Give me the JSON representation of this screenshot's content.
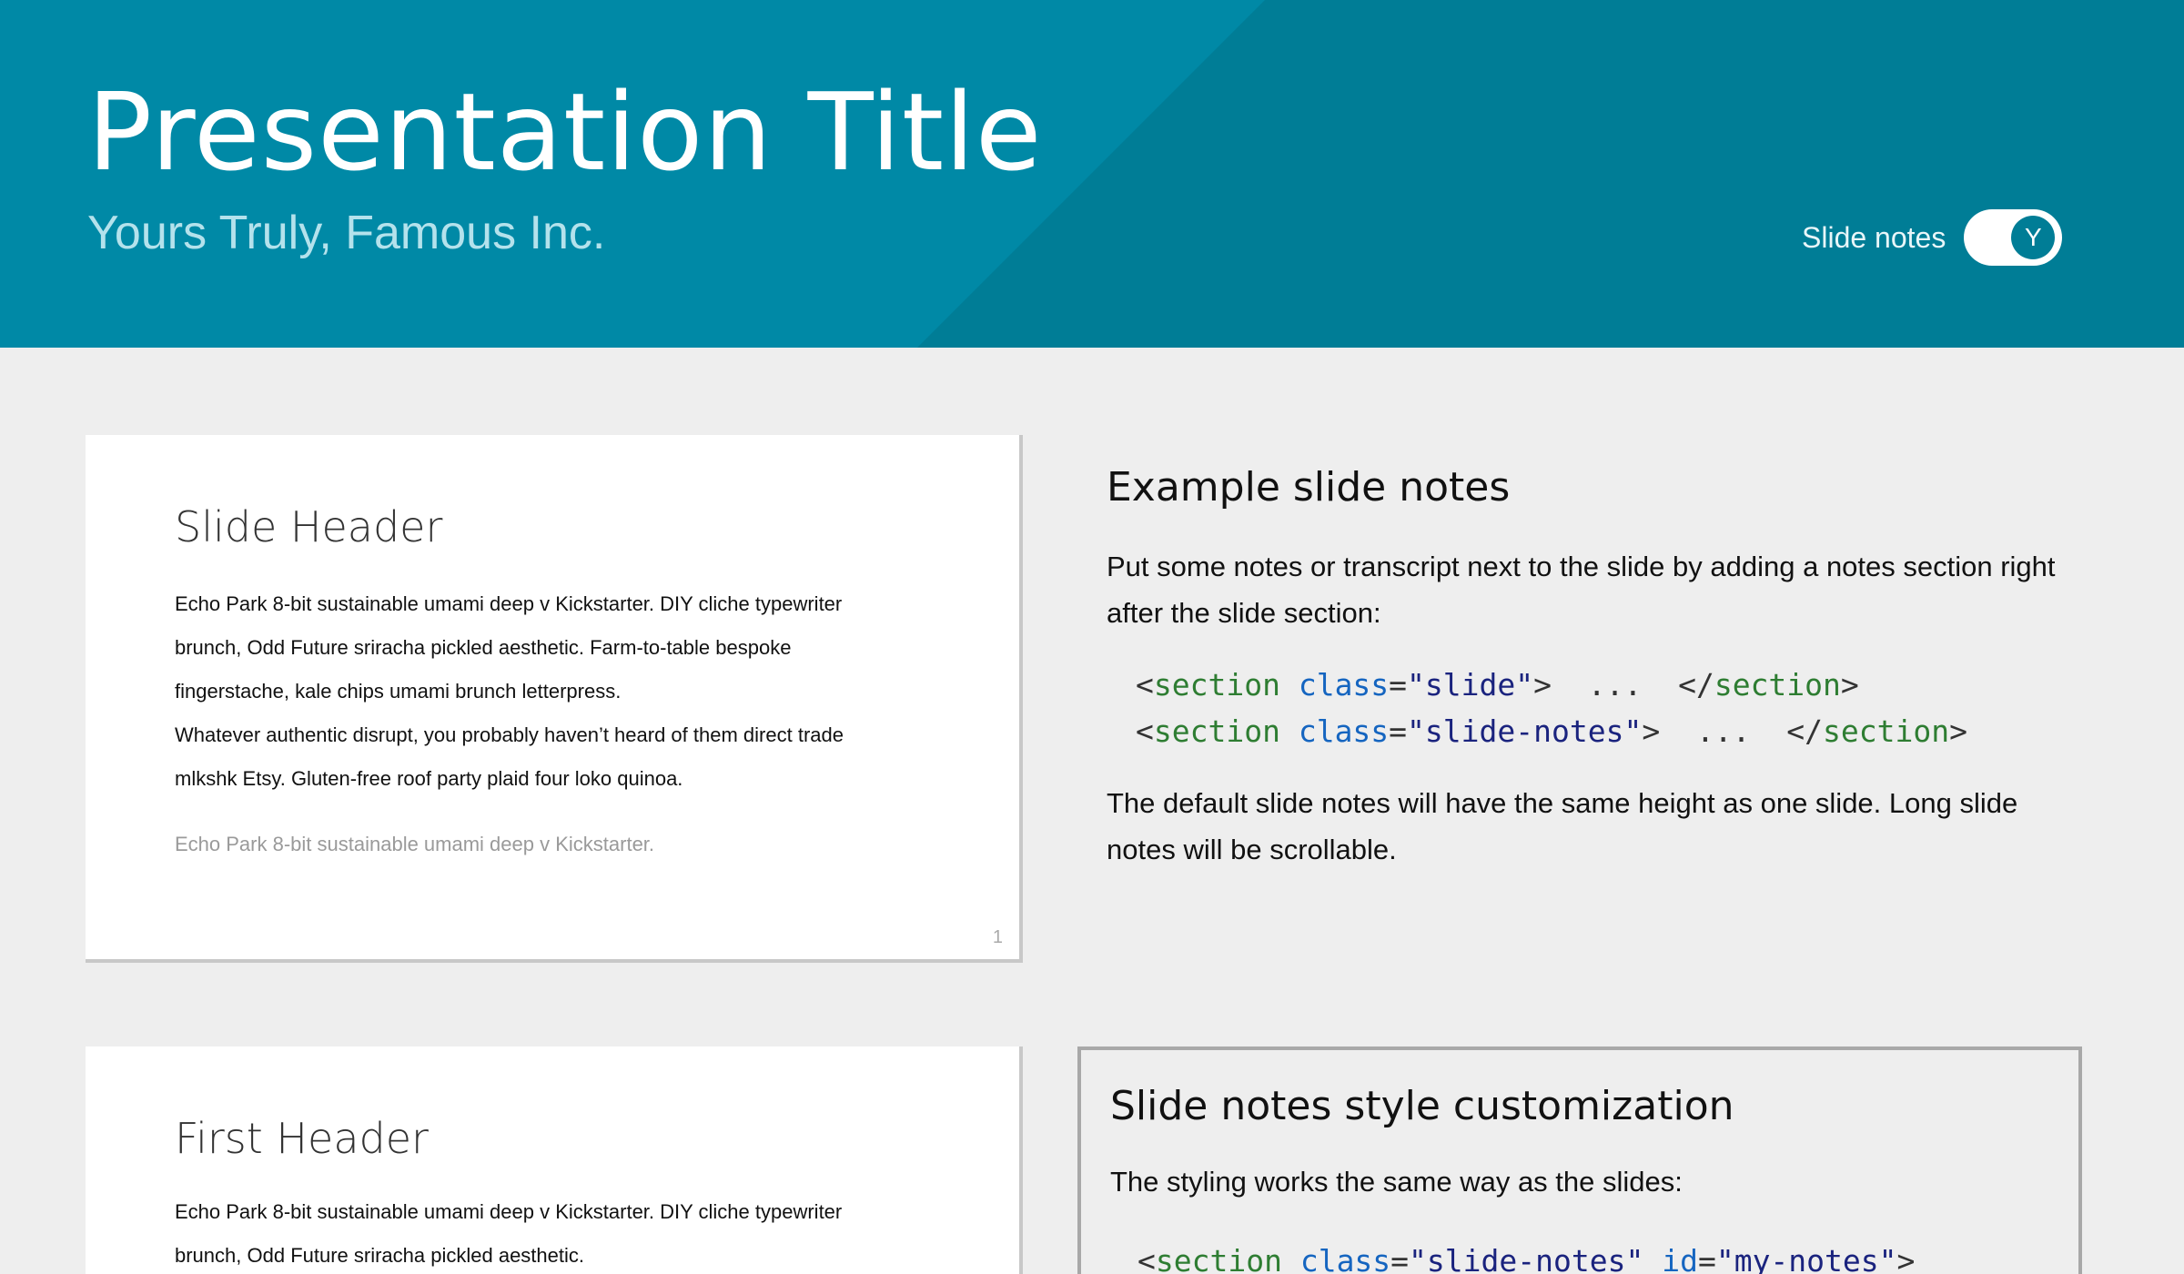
{
  "header": {
    "title": "Presentation Title",
    "subtitle": "Yours Truly, Famous Inc.",
    "notes_toggle_label": "Slide notes",
    "notes_toggle_state": "Y"
  },
  "colors": {
    "header_bg": "#0089a6",
    "header_diag": "#007d96",
    "page_bg": "#eeeeee",
    "code_tag": "#2e7d32",
    "code_attr": "#1565c0"
  },
  "slides": [
    {
      "header": "Slide Header",
      "paragraphs": [
        "Echo Park 8-bit sustainable umami deep v Kickstarter. DIY cliche typewriter brunch, Odd Future sriracha pickled aesthetic. Farm-to-table bespoke fingerstache, kale chips umami brunch letterpress.",
        "Whatever authentic disrupt, you probably haven’t heard of them direct trade mlkshk Etsy. Gluten-free roof party plaid four loko quinoa.",
        "Echo Park 8-bit sustainable umami deep v Kickstarter."
      ],
      "number": "1"
    },
    {
      "header": "First Header",
      "paragraphs": [
        "Echo Park 8-bit sustainable umami deep v Kickstarter. DIY cliche typewriter brunch, Odd Future sriracha pickled aesthetic."
      ]
    }
  ],
  "notes": [
    {
      "heading": "Example slide notes",
      "intro": "Put some notes or transcript next to the slide by adding a notes section right after the slide section:",
      "code_lines": [
        {
          "open_tag": "section",
          "attr": "class",
          "value": "\"slide\"",
          "ellipsis": "...",
          "close_tag": "section"
        },
        {
          "open_tag": "section",
          "attr": "class",
          "value": "\"slide-notes\"",
          "ellipsis": "...",
          "close_tag": "section"
        }
      ],
      "outro": "The default slide notes will have the same height as one slide. Long slide notes will be scrollable."
    },
    {
      "heading": "Slide notes style customization",
      "intro": "The styling works the same way as the slides:",
      "code_line": {
        "open_tag": "section",
        "attr1": "class",
        "value1": "\"slide-notes\"",
        "attr2": "id",
        "value2": "\"my-notes\""
      }
    }
  ]
}
